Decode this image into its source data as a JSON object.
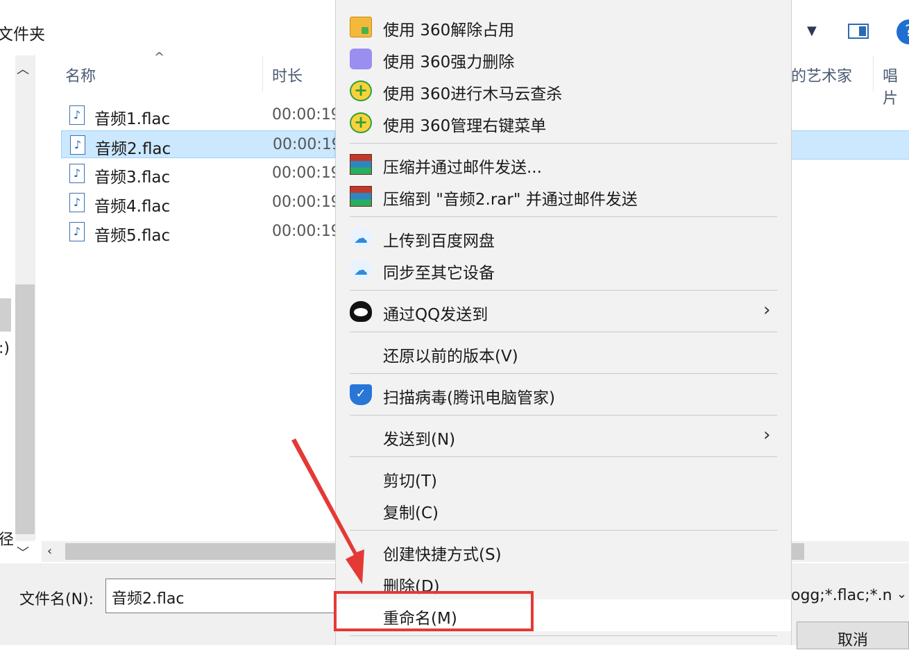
{
  "toolbar": {
    "breadcrumb": "文件夹"
  },
  "columns": {
    "name": "名称",
    "duration": "时长",
    "artist": "的艺术家",
    "album": "唱片"
  },
  "files": [
    {
      "name": "音频1.flac",
      "duration": "00:00:19"
    },
    {
      "name": "音频2.flac",
      "duration": "00:00:19"
    },
    {
      "name": "音频3.flac",
      "duration": "00:00:19"
    },
    {
      "name": "音频4.flac",
      "duration": "00:00:19"
    },
    {
      "name": "音频5.flac",
      "duration": "00:00:19"
    }
  ],
  "selected_index": 1,
  "nav": {
    "text1": ":)",
    "text2": "径"
  },
  "bottom": {
    "filename_label": "文件名(N):",
    "filename_value": "音频2.flac",
    "filter": "ogg;*.flac;*.n",
    "cancel_label": "取消"
  },
  "menu": {
    "items": [
      {
        "label": "使用 360解除占用",
        "icon": "folder-unlock-icon"
      },
      {
        "label": "使用 360强力删除",
        "icon": "puzzle-icon"
      },
      {
        "label": "使用 360进行木马云查杀",
        "icon": "360-plus-icon"
      },
      {
        "label": "使用 360管理右键菜单",
        "icon": "360-plus-icon"
      },
      {
        "label": "压缩并通过邮件发送...",
        "icon": "winrar-icon"
      },
      {
        "label": "压缩到 \"音频2.rar\" 并通过邮件发送",
        "icon": "winrar-icon"
      },
      {
        "label": "上传到百度网盘",
        "icon": "baidu-netdisk-icon"
      },
      {
        "label": "同步至其它设备",
        "icon": "baidu-netdisk-icon"
      },
      {
        "label": "通过QQ发送到",
        "icon": "qq-icon"
      },
      {
        "label": "还原以前的版本(V)"
      },
      {
        "label": "扫描病毒(腾讯电脑管家)",
        "icon": "tencent-shield-icon"
      },
      {
        "label": "发送到(N)"
      },
      {
        "label": "剪切(T)"
      },
      {
        "label": "复制(C)"
      },
      {
        "label": "创建快捷方式(S)"
      },
      {
        "label": "删除(D)"
      },
      {
        "label": "重命名(M)"
      }
    ]
  },
  "colors": {
    "selection": "#cce8ff",
    "annotation": "#e53935",
    "menu_bg": "#f2f2f2"
  }
}
